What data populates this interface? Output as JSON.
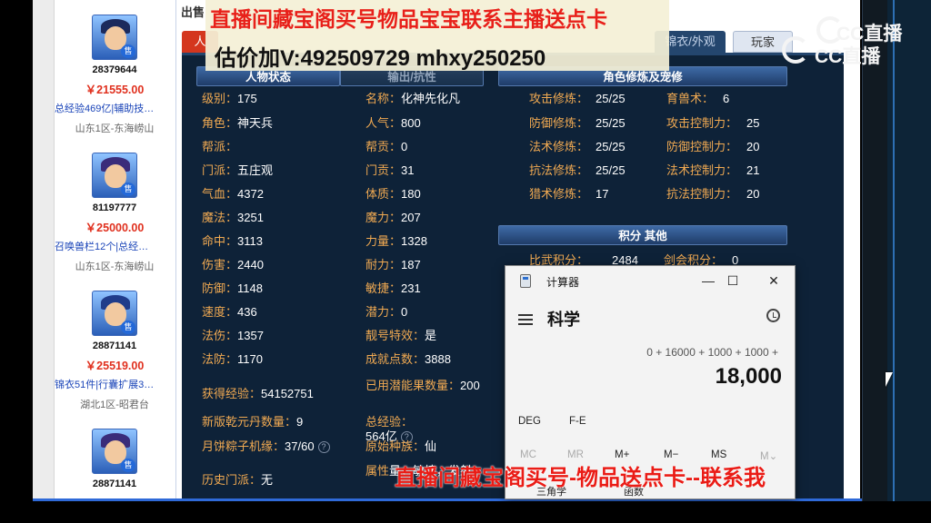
{
  "listings": [
    {
      "id": "28379644",
      "price": "￥21555.00",
      "desc": "总经验469亿|辅助技…",
      "server": "山东1区-东海崂山"
    },
    {
      "id": "81197777",
      "price": "￥25000.00",
      "desc": "召唤兽栏12个|总经…",
      "server": "山东1区-东海崂山"
    },
    {
      "id": "28871141",
      "price": "￥25519.00",
      "desc": "锦衣51件|行囊扩展3…",
      "server": "湖北1区-昭君台"
    },
    {
      "id": "28871141",
      "price": "",
      "desc": "",
      "server": ""
    }
  ],
  "sale_badge": "售",
  "header": {
    "sell_label": "出售",
    "tab_active": "人",
    "tab_fashion": "锦衣/外观",
    "tab_player": "玩家"
  },
  "sections": {
    "status": "人物状态",
    "attack_resist": "输出/抗性",
    "cultivation": "角色修炼及宠修",
    "points": "积分 其他"
  },
  "left_stats": [
    {
      "k": "级别：",
      "v": "175"
    },
    {
      "k": "角色：",
      "v": "神天兵"
    },
    {
      "k": "帮派：",
      "v": ""
    },
    {
      "k": "门派：",
      "v": "五庄观"
    },
    {
      "k": "气血：",
      "v": "4372"
    },
    {
      "k": "魔法：",
      "v": "3251"
    },
    {
      "k": "命中：",
      "v": "3113"
    },
    {
      "k": "伤害：",
      "v": "2440"
    },
    {
      "k": "防御：",
      "v": "1148"
    },
    {
      "k": "速度：",
      "v": "436"
    },
    {
      "k": "法伤：",
      "v": "1357"
    },
    {
      "k": "法防：",
      "v": "1170"
    },
    {
      "k": "获得经验：",
      "v": "54152751"
    },
    {
      "k": "新版乾元丹数量：",
      "v": "9"
    },
    {
      "k": "月饼粽子机缘：",
      "v": "37/60"
    },
    {
      "k": "历史门派：",
      "v": "无"
    }
  ],
  "mid_stats": [
    {
      "k": "名称：",
      "v": "化神先化凡"
    },
    {
      "k": "人气：",
      "v": "800"
    },
    {
      "k": "帮贡：",
      "v": "0"
    },
    {
      "k": "门贡：",
      "v": "31"
    },
    {
      "k": "体质：",
      "v": "180"
    },
    {
      "k": "魔力：",
      "v": "207"
    },
    {
      "k": "力量：",
      "v": "1328"
    },
    {
      "k": "耐力：",
      "v": "187"
    },
    {
      "k": "敏捷：",
      "v": "231"
    },
    {
      "k": "潜力：",
      "v": "0"
    },
    {
      "k": "靓号特效：",
      "v": "是"
    },
    {
      "k": "成就点数：",
      "v": "3888"
    },
    {
      "k": "已用潜能果数量：",
      "v": "200"
    },
    {
      "k": "总经验：",
      "v": "564亿"
    },
    {
      "k": "原始种族：",
      "v": "仙"
    },
    {
      "k": "属性",
      "v": "量，敏捷，发射"
    }
  ],
  "cultivation": [
    {
      "k": "攻击修炼：",
      "v": "25/25",
      "k2": "育兽术：",
      "v2": "6"
    },
    {
      "k": "防御修炼：",
      "v": "25/25",
      "k2": "攻击控制力：",
      "v2": "25"
    },
    {
      "k": "法术修炼：",
      "v": "25/25",
      "k2": "防御控制力：",
      "v2": "20"
    },
    {
      "k": "抗法修炼：",
      "v": "25/25",
      "k2": "法术控制力：",
      "v2": "21"
    },
    {
      "k": "猎术修炼：",
      "v": "17",
      "k2": "抗法控制力：",
      "v2": "20"
    }
  ],
  "points": {
    "k": "比武积分：",
    "v": "2484",
    "k2": "剑会积分：",
    "v2": "0"
  },
  "calculator": {
    "title": "计算器",
    "mode": "科学",
    "expression": "0 + 16000 + 1000 + 1000 +",
    "result": "18,000",
    "angle_deg": "DEG",
    "angle_fe": "F-E",
    "mem": [
      "MC",
      "MR",
      "M+",
      "M−",
      "MS",
      "M⌄"
    ],
    "trig": "三角学",
    "func": "函数",
    "minimize": "—",
    "maximize": "☐",
    "close": "✕"
  },
  "overlay": {
    "top_line1": "直播间藏宝阁买号物品宝宝联系主播送点卡",
    "top_line2": "估价加V:492509729    mhxy250250",
    "bottom_line": "直播间藏宝阁买号-物品送点卡--联系我"
  },
  "logo": {
    "text_top": "CC直播",
    "text_bottom": "CC直播"
  },
  "help_glyph": "?"
}
